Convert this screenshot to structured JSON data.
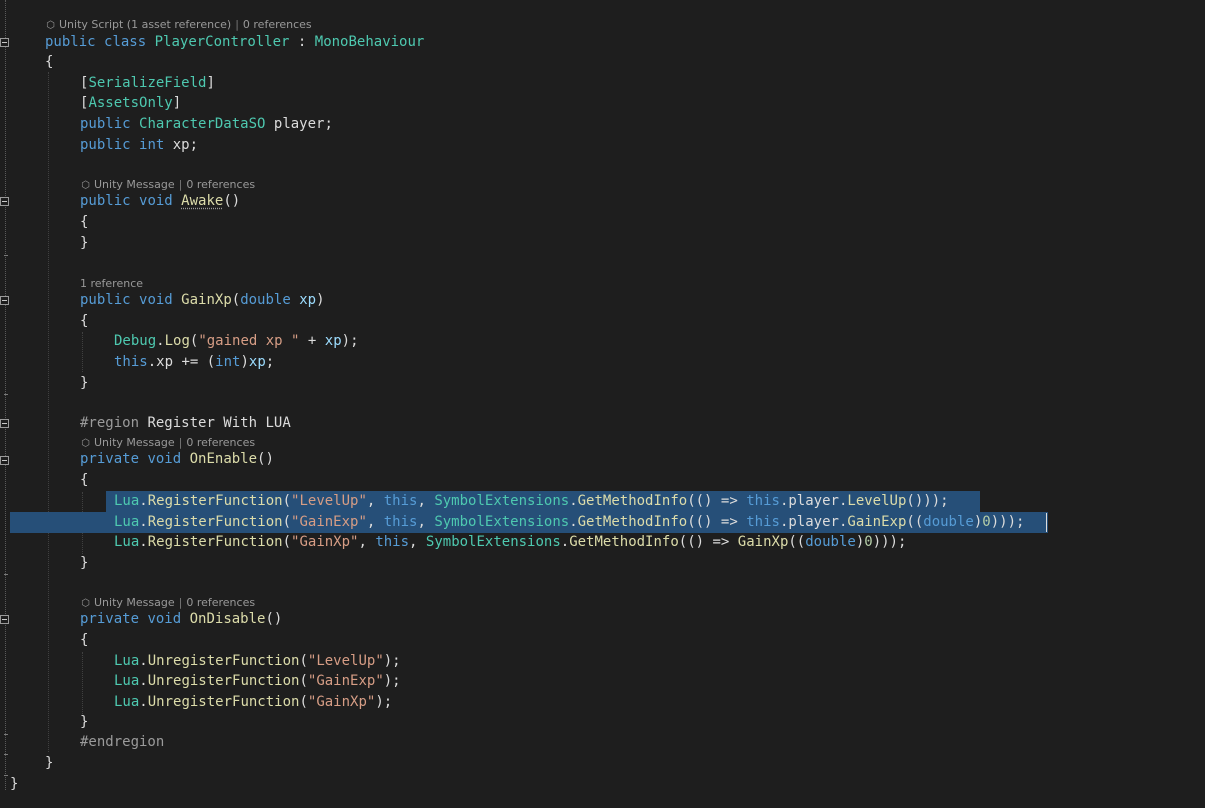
{
  "codelens": {
    "class": {
      "icon": "unity-icon",
      "text": "Unity Script (1 asset reference)",
      "refs": "0 references"
    },
    "awake": {
      "icon": "unity-icon",
      "text": "Unity Message",
      "refs": "0 references"
    },
    "gainxp": {
      "text": "1 reference"
    },
    "onenable": {
      "icon": "unity-icon",
      "text": "Unity Message",
      "refs": "0 references"
    },
    "ondisable": {
      "icon": "unity-icon",
      "text": "Unity Message",
      "refs": "0 references"
    }
  },
  "tokens": {
    "public": "public",
    "private": "private",
    "class": "class",
    "void": "void",
    "int": "int",
    "double": "double",
    "this": "this",
    "class_name": "PlayerController",
    "base_class": "MonoBehaviour",
    "attr_serialize": "SerializeField",
    "attr_assets": "AssetsOnly",
    "chardata_type": "CharacterDataSO",
    "player": "player",
    "xp": "xp",
    "awake": "Awake",
    "gainxp": "GainXp",
    "debug": "Debug",
    "log": "Log",
    "gained_str": "\"gained xp \"",
    "region": "#region",
    "region_name": "Register With LUA",
    "endregion": "#endregion",
    "onenable": "OnEnable",
    "ondisable": "OnDisable",
    "lua": "Lua",
    "register_fn": "RegisterFunction",
    "unregister_fn": "UnregisterFunction",
    "str_levelup": "\"LevelUp\"",
    "str_gainexp": "\"GainExp\"",
    "str_gainxp": "\"GainXp\"",
    "symbol_ext": "SymbolExtensions",
    "get_method_info": "GetMethodInfo",
    "levelup": "LevelUp",
    "gainexp": "GainExp",
    "zero": "0"
  }
}
